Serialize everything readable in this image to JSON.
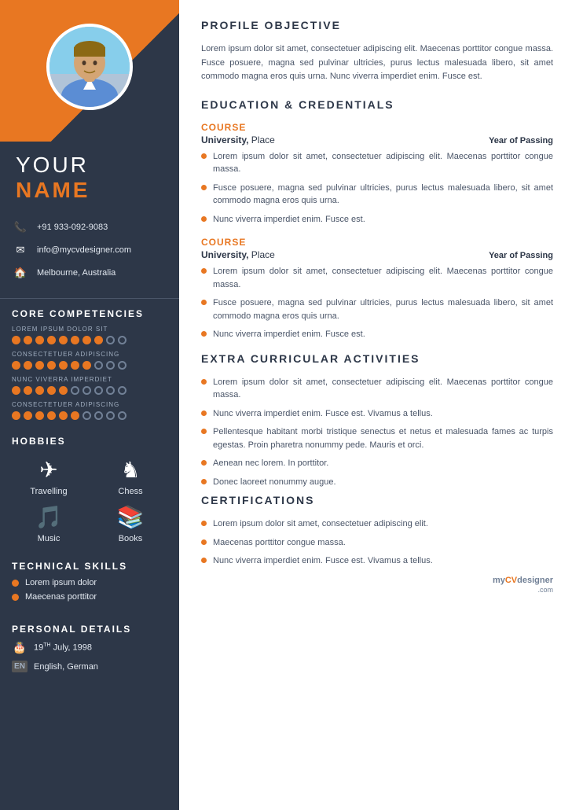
{
  "sidebar": {
    "name_prefix": "YOUR",
    "name_main": "NAME",
    "contact": {
      "phone": "+91 933-092-9083",
      "email": "info@mycvdesigner.com",
      "location": "Melbourne, Australia"
    },
    "core_competencies_title": "CORE COMPETENCIES",
    "competencies": [
      {
        "label": "LOREM IPSUM DOLOR SIT",
        "filled": 8,
        "empty": 2
      },
      {
        "label": "CONSECTETUER ADIPISCING",
        "filled": 7,
        "empty": 3
      },
      {
        "label": "NUNC VIVERRA IMPERDIET",
        "filled": 5,
        "empty": 5
      },
      {
        "label": "CONSECTETUER ADIPISCING",
        "filled": 6,
        "empty": 4
      }
    ],
    "hobbies_title": "HOBBIES",
    "hobbies": [
      {
        "label": "Travelling",
        "icon": "✈"
      },
      {
        "label": "Chess",
        "icon": "♞"
      },
      {
        "label": "Music",
        "icon": "♪"
      },
      {
        "label": "Books",
        "icon": "📖"
      }
    ],
    "technical_skills_title": "TECHNICAL SKILLS",
    "skills": [
      "Lorem ipsum dolor",
      "Maecenas porttitor"
    ],
    "personal_details_title": "PERSONAL DETAILS",
    "personal": [
      {
        "icon": "🎂",
        "text": "19TH July, 1998",
        "sup": "TH"
      },
      {
        "icon": "EN",
        "text": "English, German"
      }
    ]
  },
  "main": {
    "profile_title": "PROFILE OBJECTIVE",
    "profile_text": "Lorem ipsum dolor sit amet, consectetuer adipiscing elit. Maecenas porttitor congue massa. Fusce posuere, magna sed pulvinar ultricies, purus lectus malesuada libero, sit amet commodo magna eros quis urna. Nunc viverra imperdiet enim. Fusce est.",
    "education_title": "EDUCATION & CREDENTIALS",
    "education": [
      {
        "course_label": "COURSE",
        "university": "University,",
        "place": "Place",
        "year_label": "Year of Passing",
        "bullets": [
          "Lorem ipsum dolor sit amet, consectetuer adipiscing elit. Maecenas porttitor congue massa.",
          "Fusce posuere, magna sed pulvinar ultricies, purus lectus malesuada libero, sit amet commodo magna eros quis urna.",
          "Nunc viverra imperdiet enim. Fusce est."
        ]
      },
      {
        "course_label": "COURSE",
        "university": "University,",
        "place": "Place",
        "year_label": "Year of Passing",
        "bullets": [
          "Lorem ipsum dolor sit amet, consectetuer adipiscing elit. Maecenas porttitor congue massa.",
          "Fusce posuere, magna sed pulvinar ultricies, purus lectus malesuada libero, sit amet commodo magna eros quis urna.",
          "Nunc viverra imperdiet enim. Fusce est."
        ]
      }
    ],
    "extra_title": "EXTRA CURRICULAR ACTIVITIES",
    "extra_bullets": [
      "Lorem ipsum dolor sit amet, consectetuer adipiscing elit. Maecenas porttitor congue massa.",
      "Nunc viverra imperdiet enim. Fusce est. Vivamus a tellus.",
      "Pellentesque habitant morbi tristique senectus et netus et malesuada fames ac turpis egestas. Proin pharetra nonummy pede. Mauris et orci.",
      "Aenean nec lorem. In porttitor.",
      "Donec laoreet nonummy augue."
    ],
    "certifications_title": "CERTIFICATIONS",
    "cert_bullets": [
      "Lorem ipsum dolor sit amet, consectetuer adipiscing elit.",
      "Maecenas porttitor congue massa.",
      "Nunc viverra imperdiet enim. Fusce est. Vivamus a tellus."
    ],
    "watermark": {
      "my": "my",
      "cv": "CV",
      "designer": "designer",
      "com": ".com"
    }
  }
}
